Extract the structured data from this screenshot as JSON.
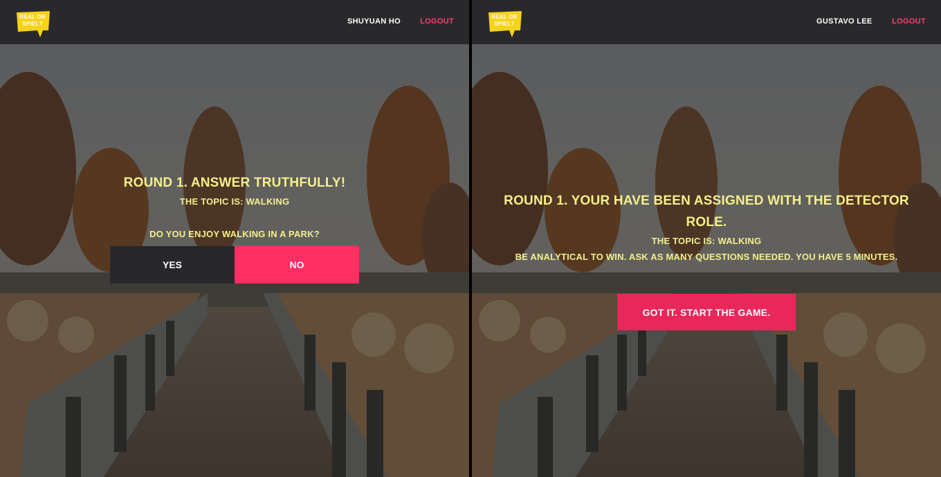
{
  "logo": {
    "line1": "REAL OR",
    "line2": "SPIEL?"
  },
  "left": {
    "user": "SHUYUAN HO",
    "logout": "LOGOUT",
    "title": "ROUND 1. ANSWER TRUTHFULLY!",
    "topic": "THE TOPIC IS: WALKING",
    "question": "DO YOU ENJOY WALKING IN A PARK?",
    "yes_label": "YES",
    "no_label": "NO"
  },
  "right": {
    "user": "GUSTAVO LEE",
    "logout": "LOGOUT",
    "title_line1": "ROUND 1. YOUR HAVE BEEN ASSIGNED WITH THE DETECTOR",
    "title_line2": "ROLE.",
    "topic": "THE TOPIC IS: WALKING",
    "instructions": "BE ANALYTICAL TO WIN. ASK AS MANY QUESTIONS NEEDED. YOU HAVE 5 MINUTES.",
    "start_label": "GOT IT. START THE GAME."
  },
  "colors": {
    "accent": "#ff2e63",
    "text_highlight": "#f4f08a",
    "navbar": "#29292c",
    "logo_yellow": "#f7d21a"
  }
}
